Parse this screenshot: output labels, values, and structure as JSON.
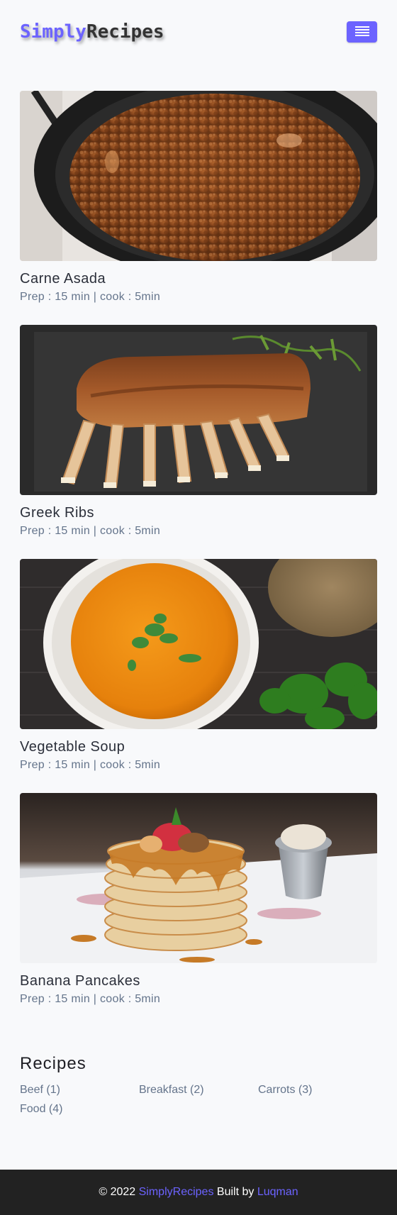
{
  "header": {
    "logo_part1": "Simply",
    "logo_part2": "Recipes",
    "menu_icon": "hamburger-menu-icon"
  },
  "colors": {
    "accent": "#6c63ff",
    "background": "#f8f9fb",
    "footer_bg": "#222222",
    "text_muted": "#64748b"
  },
  "recipes": [
    {
      "title": "Carne Asada",
      "meta": "Prep : 15 min | cook : 5min",
      "image": "photo-ground-meat-in-skillet"
    },
    {
      "title": "Greek Ribs",
      "meta": "Prep : 15 min | cook : 5min",
      "image": "photo-rack-of-ribs"
    },
    {
      "title": "Vegetable Soup",
      "meta": "Prep : 15 min | cook : 5min",
      "image": "photo-orange-soup-bowl"
    },
    {
      "title": "Banana Pancakes",
      "meta": "Prep : 15 min | cook : 5min",
      "image": "photo-pancake-stack"
    }
  ],
  "tags": {
    "title": "Recipes",
    "items": [
      "Beef (1)",
      "Breakfast (2)",
      "Carrots (3)",
      "Food (4)"
    ]
  },
  "footer": {
    "copyright": "© 2022",
    "brand": "SimplyRecipes",
    "built_by": "Built by",
    "author": "Luqman"
  }
}
